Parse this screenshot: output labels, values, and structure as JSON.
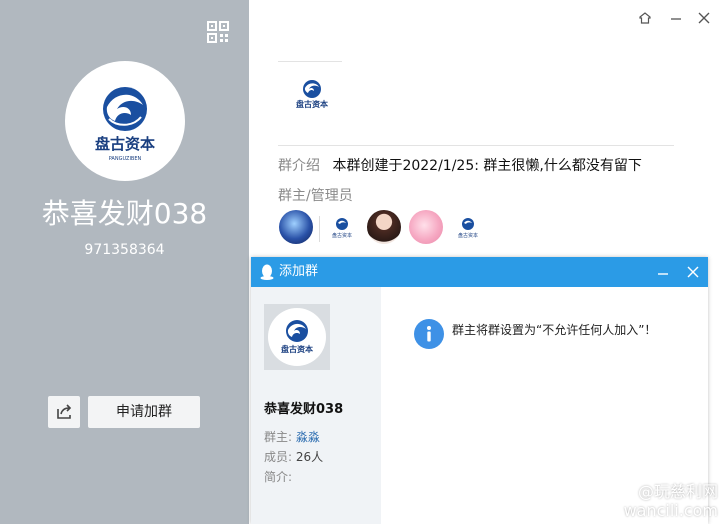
{
  "left_panel": {
    "logo_text": "盘古资本",
    "logo_subtext": "PANGUZIBEN",
    "group_name": "恭喜发财038",
    "group_id": "971358364",
    "apply_button": "申请加群"
  },
  "right_panel": {
    "intro_label": "群介绍",
    "intro_text": "本群创建于2022/1/25: 群主很懒,什么都没有留下",
    "admins_label": "群主/管理员"
  },
  "dialog": {
    "title": "添加群",
    "group_name": "恭喜发财038",
    "owner_label": "群主:",
    "owner_value": "淼淼",
    "members_label": "成员:",
    "members_value": "26人",
    "desc_label": "简介:",
    "message": "群主将群设置为“不允许任何人加入”！"
  },
  "watermark": {
    "line1": "@玩慈利网",
    "line2": "wancili.com"
  },
  "colors": {
    "left_panel_bg": "#b1b8bf",
    "titlebar_blue": "#2b9be6",
    "logo_blue": "#1a4fa0"
  }
}
